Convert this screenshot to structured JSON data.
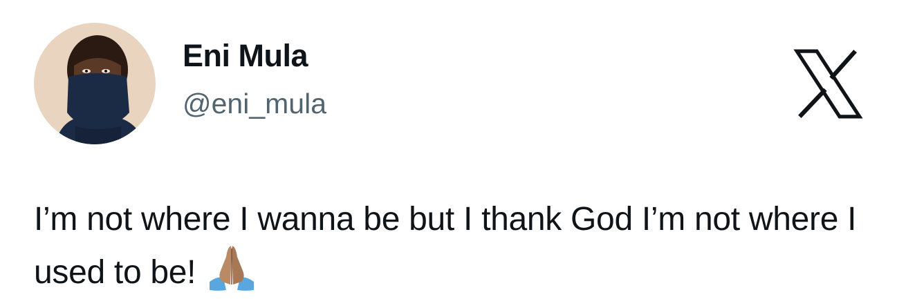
{
  "author": {
    "display_name": "Eni Mula",
    "handle": "@eni_mula",
    "avatar_icon": "masked-person-avatar"
  },
  "platform": {
    "logo_icon": "x-logo-icon"
  },
  "tweet": {
    "text": "I’m not where I wanna be but I thank God I’m not where I used to be!",
    "emoji": "folded-hands-emoji"
  },
  "colors": {
    "text": "#0f1419",
    "handle": "#536471",
    "avatar_bg": "#e8d4bf",
    "mask": "#1c2b45",
    "emoji_skin": "#b98a66",
    "emoji_sleeve": "#5aa7e0"
  }
}
